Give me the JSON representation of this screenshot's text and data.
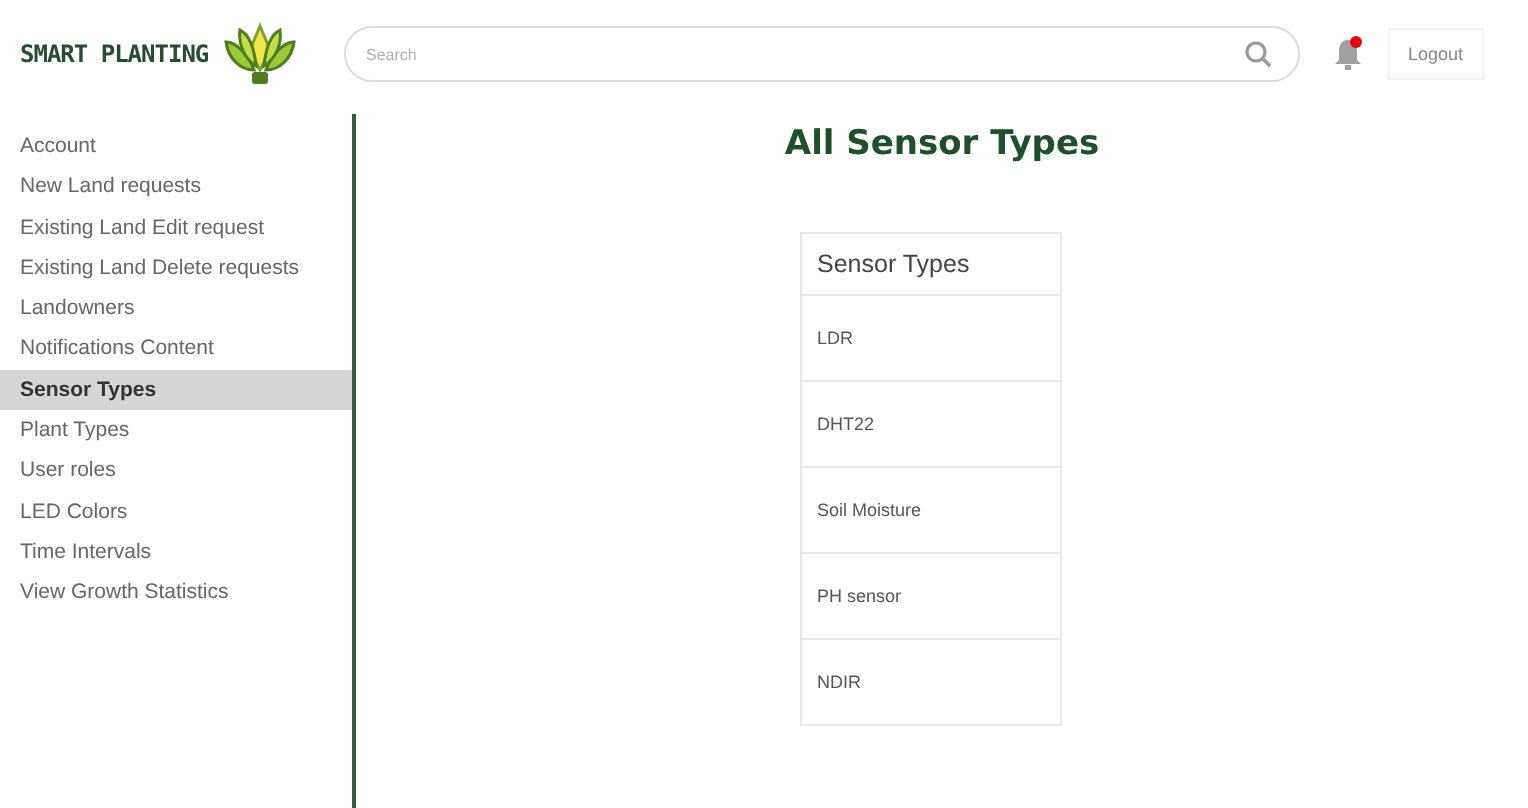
{
  "header": {
    "logo_text": "SMART PLANTING",
    "search": {
      "placeholder": "Search"
    },
    "notification_dot": true,
    "logout": "Logout"
  },
  "sidebar": {
    "items": [
      {
        "label": "Account",
        "selected": false
      },
      {
        "label": "New Land requests",
        "selected": false
      },
      {
        "label": "Existing Land Edit request",
        "selected": false
      },
      {
        "label": "Existing Land Delete requests",
        "selected": false
      },
      {
        "label": "Landowners",
        "selected": false
      },
      {
        "label": "Notifications Content",
        "selected": false
      },
      {
        "label": "Sensor Types",
        "selected": true
      },
      {
        "label": "Plant Types",
        "selected": false
      },
      {
        "label": "User roles",
        "selected": false
      },
      {
        "label": "LED Colors",
        "selected": false
      },
      {
        "label": "Time Intervals",
        "selected": false
      },
      {
        "label": "View Growth Statistics",
        "selected": false
      }
    ]
  },
  "main": {
    "title": "All Sensor Types",
    "table": {
      "columns": [
        "Sensor Types"
      ],
      "rows": [
        [
          "LDR"
        ],
        [
          "DHT22"
        ],
        [
          "Soil Moisture"
        ],
        [
          "PH sensor"
        ],
        [
          "NDIR"
        ]
      ]
    }
  }
}
